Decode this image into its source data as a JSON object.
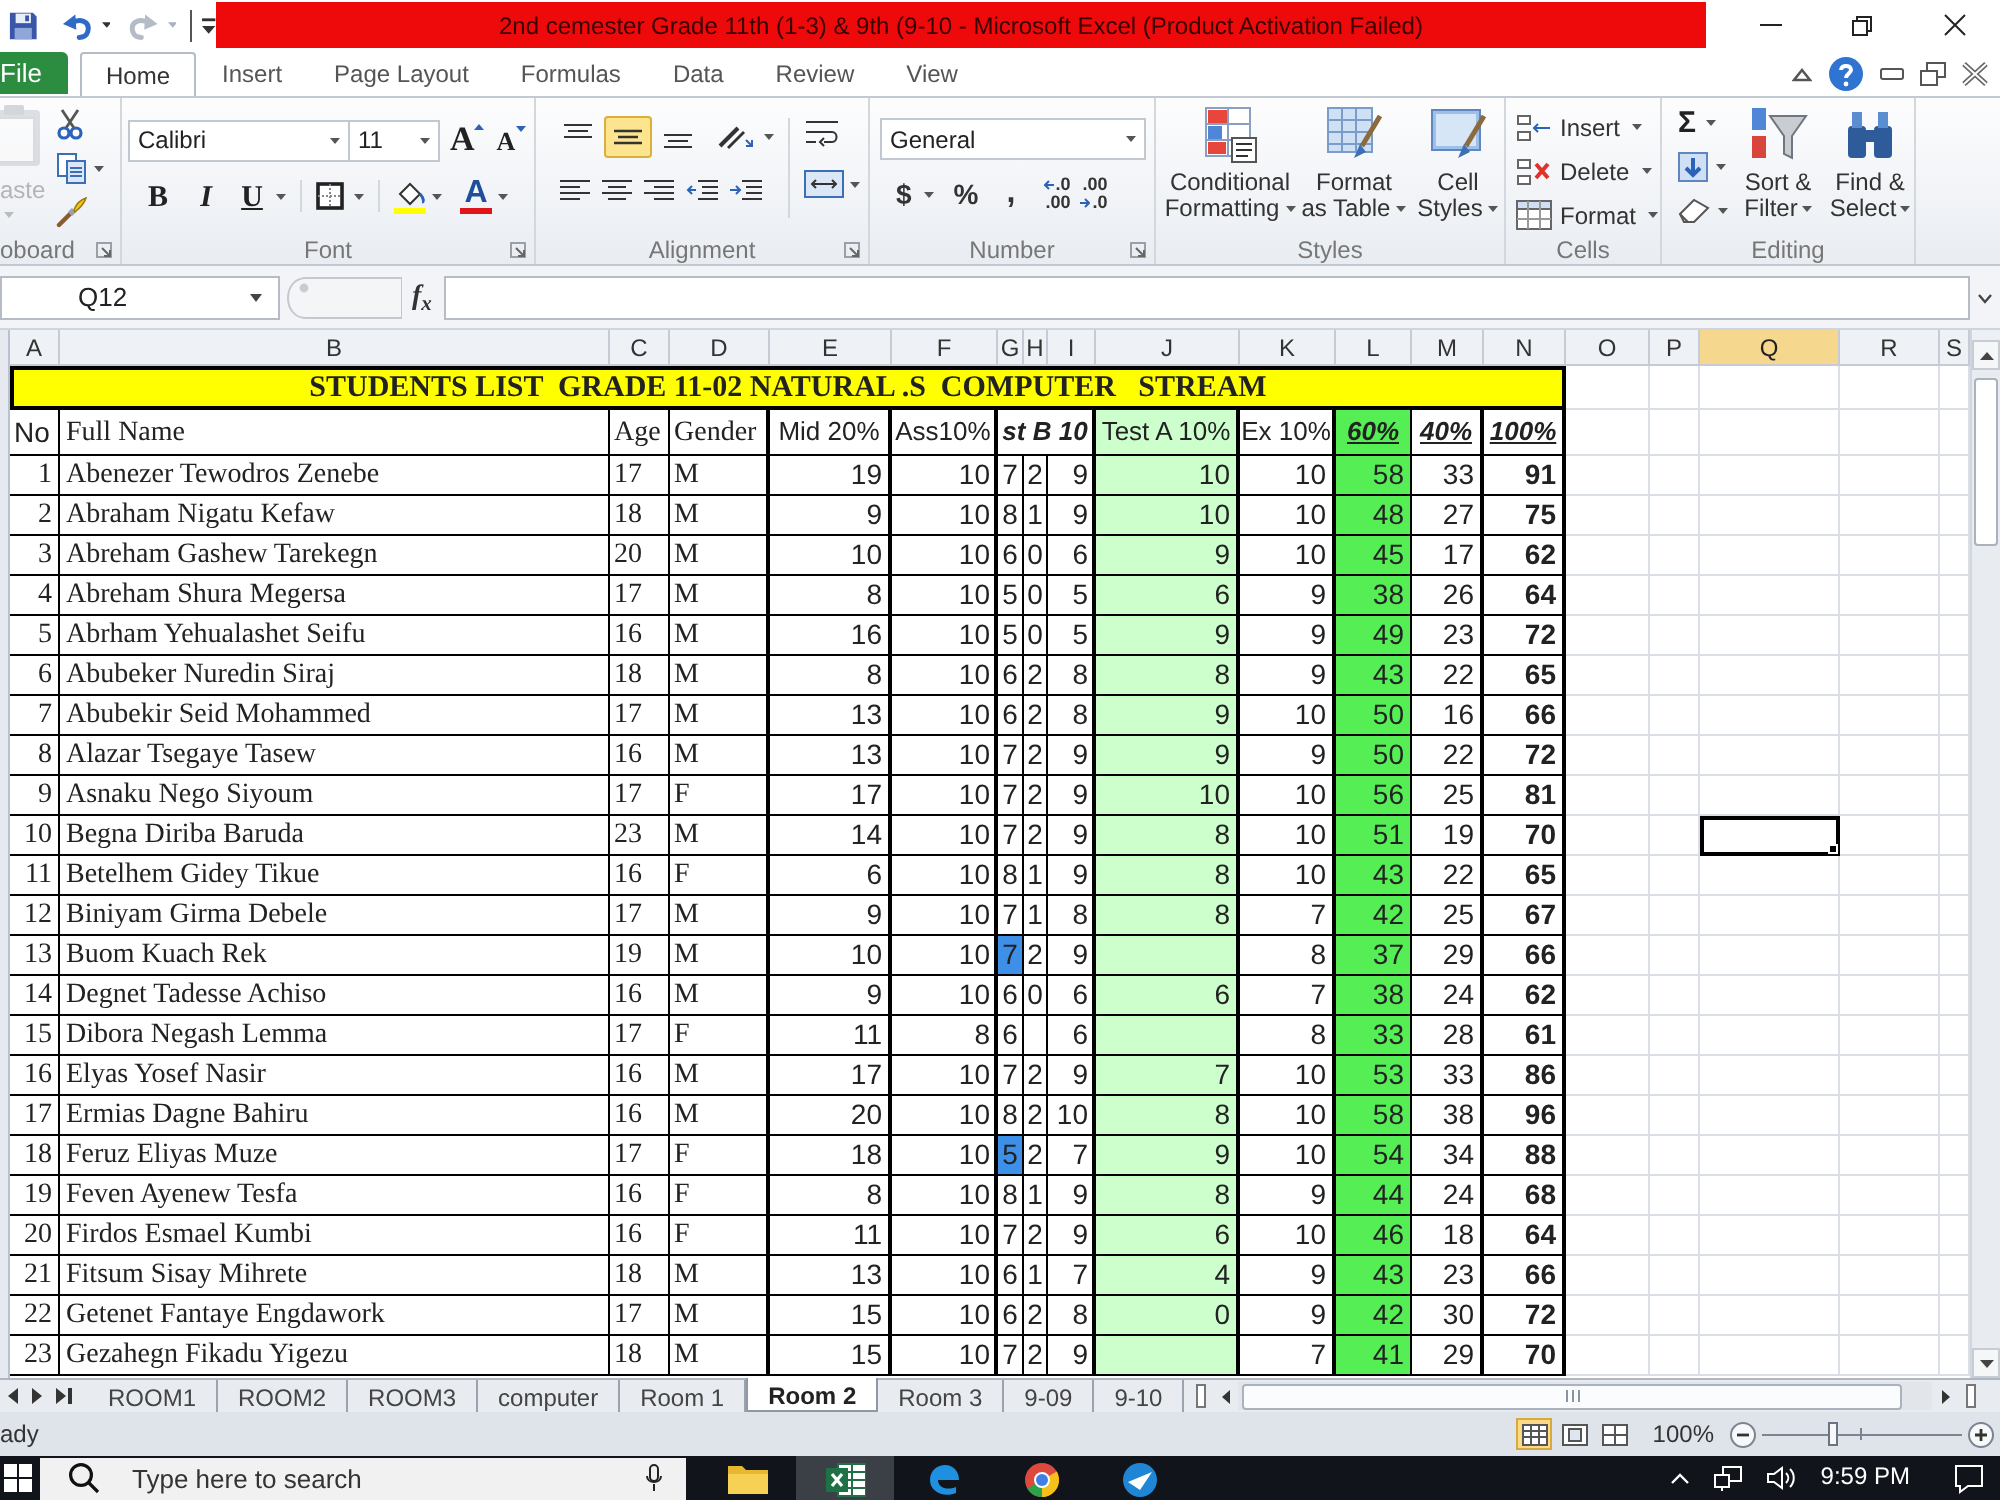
{
  "title_bar": {
    "title": "2nd cemester Grade 11th (1-3) & 9th (9-10 - Microsoft Excel (Product Activation Failed)"
  },
  "ribbon_tabs": [
    {
      "label": "File",
      "kind": "file",
      "selected": false
    },
    {
      "label": "Home",
      "kind": "tab",
      "selected": true
    },
    {
      "label": "Insert",
      "kind": "tab",
      "selected": false
    },
    {
      "label": "Page Layout",
      "kind": "tab",
      "selected": false
    },
    {
      "label": "Formulas",
      "kind": "tab",
      "selected": false
    },
    {
      "label": "Data",
      "kind": "tab",
      "selected": false
    },
    {
      "label": "Review",
      "kind": "tab",
      "selected": false
    },
    {
      "label": "View",
      "kind": "tab",
      "selected": false
    }
  ],
  "ribbon": {
    "clipboard": {
      "paste": {
        "label": "aste",
        "disabled": true
      },
      "label": "oboard"
    },
    "font": {
      "font_name": "Calibri",
      "font_size": "11",
      "grow": "A",
      "shrink": "A",
      "bold": "B",
      "italic": "I",
      "underline": "U",
      "font_color": "A",
      "label": "Font"
    },
    "alignment": {
      "vertical": [
        {
          "selected": false
        },
        {
          "selected": true
        },
        {
          "selected": false
        }
      ],
      "label": "Alignment"
    },
    "number": {
      "format": "General",
      "currency": "$",
      "percent": "%",
      "comma": ",",
      "decimals": [
        {
          "top": ".0",
          "bottom": ".00"
        },
        {
          "top": ".00",
          "bottom": ".0"
        }
      ],
      "label": "Number"
    },
    "styles": {
      "buttons": [
        {
          "lines": [
            "Conditional",
            "Formatting"
          ]
        },
        {
          "lines": [
            "Format",
            "as Table"
          ]
        },
        {
          "lines": [
            "Cell",
            "Styles"
          ]
        }
      ],
      "label": "Styles"
    },
    "cells": {
      "buttons": [
        "Insert",
        "Delete",
        "Format"
      ],
      "label": "Cells"
    },
    "editing": {
      "autosum": "Σ",
      "buttons": [
        {
          "lines": [
            "Sort &",
            "Filter"
          ]
        },
        {
          "lines": [
            "Find &",
            "Select"
          ]
        }
      ],
      "label": "Editing"
    }
  },
  "formula_bar": {
    "name_box": "Q12",
    "function_button": "f$_{x}$"
  },
  "sheet": {
    "columns": [
      {
        "label": "A",
        "selected": false
      },
      {
        "label": "B",
        "selected": false
      },
      {
        "label": "C",
        "selected": false
      },
      {
        "label": "D",
        "selected": false
      },
      {
        "label": "E",
        "selected": false
      },
      {
        "label": "F",
        "selected": false
      },
      {
        "label": "G",
        "selected": false
      },
      {
        "label": "H",
        "selected": false
      },
      {
        "label": "I",
        "selected": false
      },
      {
        "label": "J",
        "selected": false
      },
      {
        "label": "K",
        "selected": false
      },
      {
        "label": "L",
        "selected": false
      },
      {
        "label": "M",
        "selected": false
      },
      {
        "label": "N",
        "selected": false
      },
      {
        "label": "O",
        "selected": false
      },
      {
        "label": "P",
        "selected": false
      },
      {
        "label": "Q",
        "selected": true
      },
      {
        "label": "R",
        "selected": false
      },
      {
        "label": "S",
        "selected": false
      }
    ],
    "title": "STUDENTS LIST  GRADE 11-02 NATURAL .S  COMPUTER   STREAM",
    "header": [
      "No",
      "Full Name",
      "Age",
      "Gender",
      "Mid 20%",
      "Ass10%",
      "st B 10",
      "Test A 10%",
      "Ex 10%",
      "60%",
      "40%",
      "100%"
    ],
    "rows": [
      {
        "cells": [
          "1",
          "Abenezer Tewodros Zenebe",
          "17",
          "M",
          "19",
          "10",
          "7",
          "2",
          "9",
          "10",
          "10",
          "58",
          "33",
          "91"
        ],
        "g_highlighted": false,
        "q_selected": false
      },
      {
        "cells": [
          "2",
          "Abraham Nigatu Kefaw",
          "18",
          "M",
          "9",
          "10",
          "8",
          "1",
          "9",
          "10",
          "10",
          "48",
          "27",
          "75"
        ],
        "g_highlighted": false,
        "q_selected": false
      },
      {
        "cells": [
          "3",
          "Abreham Gashew Tarekegn",
          "20",
          "M",
          "10",
          "10",
          "6",
          "0",
          "6",
          "9",
          "10",
          "45",
          "17",
          "62"
        ],
        "g_highlighted": false,
        "q_selected": false
      },
      {
        "cells": [
          "4",
          "Abreham Shura Megersa",
          "17",
          "M",
          "8",
          "10",
          "5",
          "0",
          "5",
          "6",
          "9",
          "38",
          "26",
          "64"
        ],
        "g_highlighted": false,
        "q_selected": false
      },
      {
        "cells": [
          "5",
          "Abrham Yehualashet Seifu",
          "16",
          "M",
          "16",
          "10",
          "5",
          "0",
          "5",
          "9",
          "9",
          "49",
          "23",
          "72"
        ],
        "g_highlighted": false,
        "q_selected": false
      },
      {
        "cells": [
          "6",
          "Abubeker Nuredin Siraj",
          "18",
          "M",
          "8",
          "10",
          "6",
          "2",
          "8",
          "8",
          "9",
          "43",
          "22",
          "65"
        ],
        "g_highlighted": false,
        "q_selected": false
      },
      {
        "cells": [
          "7",
          "Abubekir Seid Mohammed",
          "17",
          "M",
          "13",
          "10",
          "6",
          "2",
          "8",
          "9",
          "10",
          "50",
          "16",
          "66"
        ],
        "g_highlighted": false,
        "q_selected": false
      },
      {
        "cells": [
          "8",
          "Alazar Tsegaye Tasew",
          "16",
          "M",
          "13",
          "10",
          "7",
          "2",
          "9",
          "9",
          "9",
          "50",
          "22",
          "72"
        ],
        "g_highlighted": false,
        "q_selected": false
      },
      {
        "cells": [
          "9",
          "Asnaku Nego Siyoum",
          "17",
          "F",
          "17",
          "10",
          "7",
          "2",
          "9",
          "10",
          "10",
          "56",
          "25",
          "81"
        ],
        "g_highlighted": false,
        "q_selected": false
      },
      {
        "cells": [
          "10",
          "Begna Diriba Baruda",
          "23",
          "M",
          "14",
          "10",
          "7",
          "2",
          "9",
          "8",
          "10",
          "51",
          "19",
          "70"
        ],
        "g_highlighted": false,
        "q_selected": true
      },
      {
        "cells": [
          "11",
          "Betelhem Gidey Tikue",
          "16",
          "F",
          "6",
          "10",
          "8",
          "1",
          "9",
          "8",
          "10",
          "43",
          "22",
          "65"
        ],
        "g_highlighted": false,
        "q_selected": false
      },
      {
        "cells": [
          "12",
          "Biniyam Girma Debele",
          "17",
          "M",
          "9",
          "10",
          "7",
          "1",
          "8",
          "8",
          "7",
          "42",
          "25",
          "67"
        ],
        "g_highlighted": false,
        "q_selected": false
      },
      {
        "cells": [
          "13",
          "Buom Kuach Rek",
          "19",
          "M",
          "10",
          "10",
          "7",
          "2",
          "9",
          null,
          "8",
          "37",
          "29",
          "66"
        ],
        "g_highlighted": true,
        "q_selected": false
      },
      {
        "cells": [
          "14",
          "Degnet Tadesse Achiso",
          "16",
          "M",
          "9",
          "10",
          "6",
          "0",
          "6",
          "6",
          "7",
          "38",
          "24",
          "62"
        ],
        "g_highlighted": false,
        "q_selected": false
      },
      {
        "cells": [
          "15",
          "Dibora Negash Lemma",
          "17",
          "F",
          "11",
          "8",
          "6",
          null,
          "6",
          null,
          "8",
          "33",
          "28",
          "61"
        ],
        "g_highlighted": false,
        "q_selected": false
      },
      {
        "cells": [
          "16",
          "Elyas Yosef Nasir",
          "16",
          "M",
          "17",
          "10",
          "7",
          "2",
          "9",
          "7",
          "10",
          "53",
          "33",
          "86"
        ],
        "g_highlighted": false,
        "q_selected": false
      },
      {
        "cells": [
          "17",
          "Ermias Dagne Bahiru",
          "16",
          "M",
          "20",
          "10",
          "8",
          "2",
          "10",
          "8",
          "10",
          "58",
          "38",
          "96"
        ],
        "g_highlighted": false,
        "q_selected": false
      },
      {
        "cells": [
          "18",
          "Feruz Eliyas Muze",
          "17",
          "F",
          "18",
          "10",
          "5",
          "2",
          "7",
          "9",
          "10",
          "54",
          "34",
          "88"
        ],
        "g_highlighted": true,
        "q_selected": false
      },
      {
        "cells": [
          "19",
          "Feven Ayenew Tesfa",
          "16",
          "F",
          "8",
          "10",
          "8",
          "1",
          "9",
          "8",
          "9",
          "44",
          "24",
          "68"
        ],
        "g_highlighted": false,
        "q_selected": false
      },
      {
        "cells": [
          "20",
          "Firdos Esmael Kumbi",
          "16",
          "F",
          "11",
          "10",
          "7",
          "2",
          "9",
          "6",
          "10",
          "46",
          "18",
          "64"
        ],
        "g_highlighted": false,
        "q_selected": false
      },
      {
        "cells": [
          "21",
          "Fitsum Sisay Mihrete",
          "18",
          "M",
          "13",
          "10",
          "6",
          "1",
          "7",
          "4",
          "9",
          "43",
          "23",
          "66"
        ],
        "g_highlighted": false,
        "q_selected": false
      },
      {
        "cells": [
          "22",
          "Getenet Fantaye Engdawork",
          "17",
          "M",
          "15",
          "10",
          "6",
          "2",
          "8",
          "0",
          "9",
          "42",
          "30",
          "72"
        ],
        "g_highlighted": false,
        "q_selected": false
      },
      {
        "cells": [
          "23",
          "Gezahegn Fikadu Yigezu",
          "18",
          "M",
          "15",
          "10",
          "7",
          "2",
          "9",
          null,
          "7",
          "41",
          "29",
          "70"
        ],
        "g_highlighted": false,
        "q_selected": false
      }
    ]
  },
  "sheet_tabs": [
    {
      "label": "ROOM1",
      "selected": false
    },
    {
      "label": "ROOM2",
      "selected": false
    },
    {
      "label": "ROOM3",
      "selected": false
    },
    {
      "label": "computer",
      "selected": false
    },
    {
      "label": "Room 1",
      "selected": false
    },
    {
      "label": "Room 2",
      "selected": true
    },
    {
      "label": "Room 3",
      "selected": false
    },
    {
      "label": "9-09",
      "selected": false
    },
    {
      "label": "9-10",
      "selected": false
    }
  ],
  "status_bar": {
    "mode": "ady",
    "views": [
      {
        "selected": true
      },
      {
        "selected": false
      },
      {
        "selected": false
      }
    ],
    "zoom": "100%",
    "zoom_slider": {
      "level": 0.35
    }
  },
  "taskbar": {
    "search": {
      "placeholder": "Type here to search"
    },
    "apps": [
      {
        "kind": "folder",
        "selected": false
      },
      {
        "kind": "excel",
        "selected": true
      },
      {
        "kind": "edge",
        "selected": false
      },
      {
        "kind": "chrome",
        "selected": false
      },
      {
        "kind": "app",
        "selected": false
      }
    ],
    "time": "9:59 PM"
  }
}
